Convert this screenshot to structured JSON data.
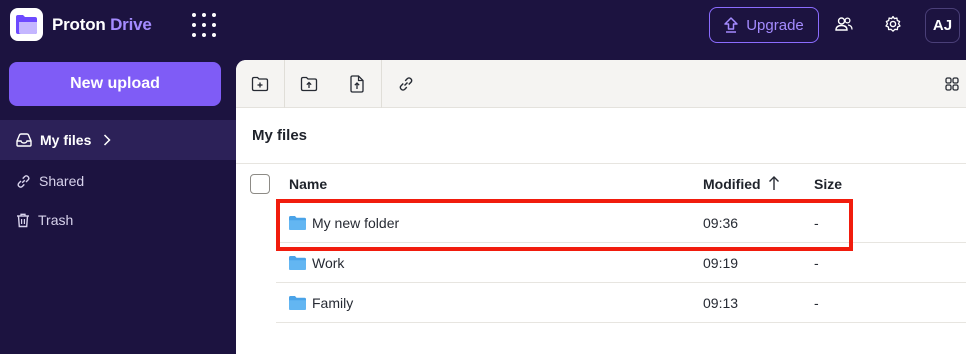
{
  "app": {
    "brand_name": "Proton",
    "brand_product": "Drive",
    "accent_color": "#7f5cf6"
  },
  "topbar": {
    "upgrade_label": "Upgrade",
    "avatar_initials": "AJ"
  },
  "sidebar": {
    "new_upload_label": "New upload",
    "items": [
      {
        "label": "My files",
        "icon": "inbox-icon",
        "active": true
      },
      {
        "label": "Shared",
        "icon": "link-icon",
        "active": false
      },
      {
        "label": "Trash",
        "icon": "trash-icon",
        "active": false
      }
    ]
  },
  "main": {
    "title": "My files",
    "columns": {
      "name": "Name",
      "modified": "Modified",
      "size": "Size"
    },
    "rows": [
      {
        "name": "My new folder",
        "modified": "09:36",
        "size": "-",
        "icon": "folder-icon"
      },
      {
        "name": "Work",
        "modified": "09:19",
        "size": "-",
        "icon": "folder-icon"
      },
      {
        "name": "Family",
        "modified": "09:13",
        "size": "-",
        "icon": "folder-icon"
      }
    ],
    "highlight_color": "#f11c0d"
  }
}
